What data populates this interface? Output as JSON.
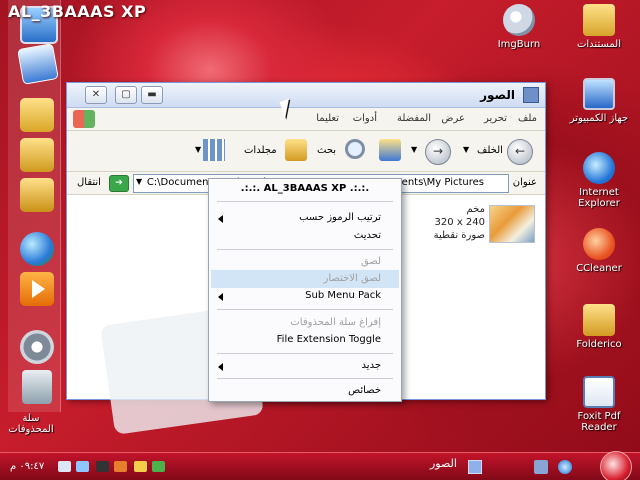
{
  "brand": "AL_3BAAAS XP",
  "quick_launch": {
    "items": [
      "computer-icon",
      "internet-explorer-icon",
      "folder-icon",
      "folder-icon",
      "folder-icon",
      "globe-icon",
      "media-player-icon",
      "settings-gear-icon",
      "recycle-bin-icon"
    ],
    "recycle_bin_label": "سلة المحذوفات"
  },
  "desktop_icons": [
    {
      "label": "ImgBurn",
      "icon": "disc-icon"
    },
    {
      "label": "المستندات",
      "icon": "folder-icon"
    },
    {
      "label": "جهاز الكمبيوتر",
      "icon": "computer-icon"
    },
    {
      "label": "Internet Explorer",
      "icon": "internet-explorer-icon"
    },
    {
      "label": "CCleaner",
      "icon": "ccleaner-icon"
    },
    {
      "label": "Folderico",
      "icon": "folder-icon"
    },
    {
      "label": "Foxit Pdf Reader",
      "icon": "pdf-icon"
    }
  ],
  "window": {
    "title": "الصور",
    "menu": [
      "ملف",
      "تحرير",
      "عرض",
      "المفضلة",
      "أدوات",
      "تعليما"
    ],
    "toolbar": {
      "back": "الخلف",
      "search": "بحث",
      "folders": "مجلدات"
    },
    "address_label": "عنوان",
    "address_value": "C:\\Documents and Settings\\AL_3BAAAS\\My Documents\\My Pictures",
    "go_label": "انتقال",
    "file": {
      "name": "مخم",
      "dims": "320 x 240",
      "type": "صورة نقطية"
    }
  },
  "context_menu": {
    "title": ".:.:.  AL_3BAAAS XP  .:.:.",
    "items": [
      {
        "label": "ترتيب الرموز حسب",
        "submenu": true,
        "disabled": false
      },
      {
        "label": "تحديث",
        "submenu": false,
        "disabled": false
      },
      {
        "label": "لصق",
        "submenu": false,
        "disabled": true
      },
      {
        "label": "لصق الاختصار",
        "submenu": false,
        "disabled": true,
        "highlighted": true
      },
      {
        "label": "Sub Menu Pack",
        "submenu": true,
        "disabled": false
      },
      {
        "label": "إفراغ سلة المحذوفات",
        "submenu": false,
        "disabled": true
      },
      {
        "label": "File Extension Toggle",
        "submenu": false,
        "disabled": false
      },
      {
        "label": "جديد",
        "submenu": true,
        "disabled": false
      },
      {
        "label": "خصائص",
        "submenu": false,
        "disabled": false
      }
    ]
  },
  "taskbar": {
    "task_label": "الصور",
    "clock": "٠٩:٤٧ م"
  },
  "colors": {
    "accent": "#c71d2c",
    "highlight": "#d2e5f7",
    "window_bg": "#ece9d8"
  }
}
